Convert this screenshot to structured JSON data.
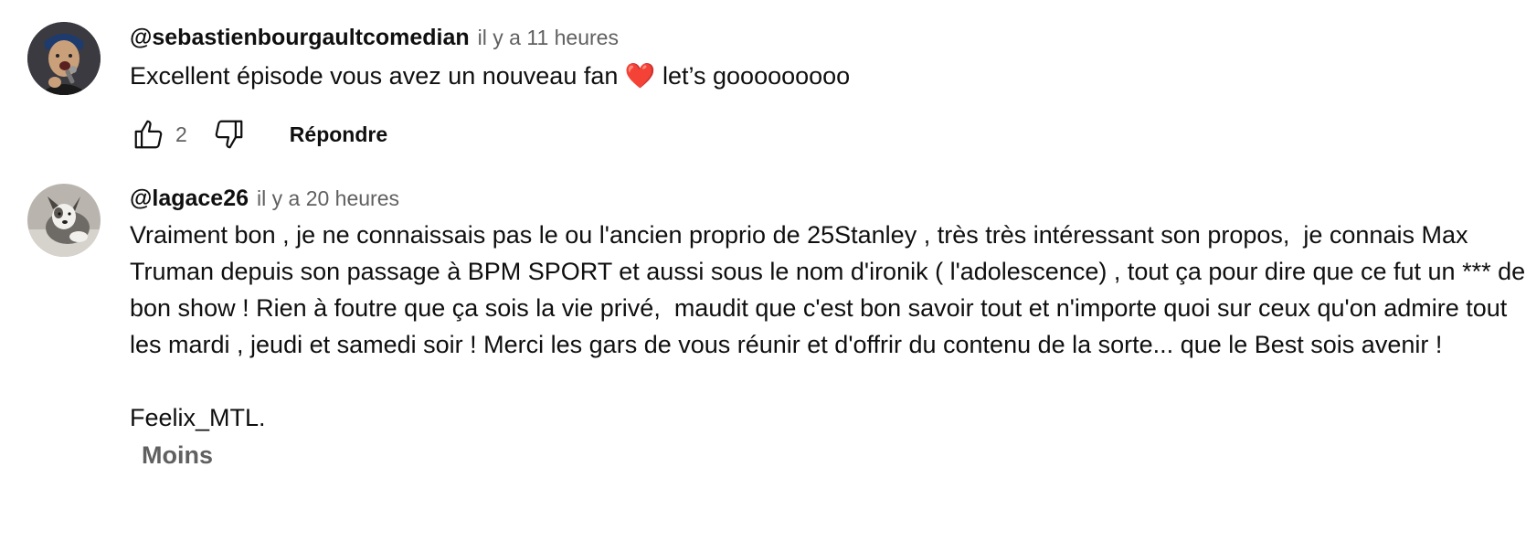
{
  "comments": [
    {
      "author": "@sebastienbourgaultcomedian",
      "time": "il y a 11 heures",
      "text_before_heart": "Excellent épisode vous avez un nouveau fan ",
      "heart": "❤️",
      "text_after_heart": " let’s gooooooooo",
      "likes": "2",
      "reply_label": "Répondre",
      "avatar_icon": "avatar-comedian-with-microphone"
    },
    {
      "author": "@lagace26",
      "time": "il y a 20 heures",
      "text": "Vraiment bon , je ne connaissais pas le ou l'ancien proprio de 25Stanley , très très intéressant son propos,  je connais Max Truman depuis son passage à BPM SPORT et aussi sous le nom d'ironik ( l'adolescence) , tout ça pour dire que ce fut un *** de bon show ! Rien à foutre que ça sois la vie privé,  maudit que c'est bon savoir tout et n'importe quoi sur ceux qu'on admire tout les mardi , jeudi et samedi soir ! Merci les gars de vous réunir et d'offrir du contenu de la sorte... que le Best sois avenir !\n\nFeelix_MTL.",
      "less_label": "Moins",
      "avatar_icon": "avatar-dog"
    }
  ],
  "colors": {
    "text": "#0f0f0f",
    "secondary": "#606060",
    "heart": "#e0243a"
  }
}
